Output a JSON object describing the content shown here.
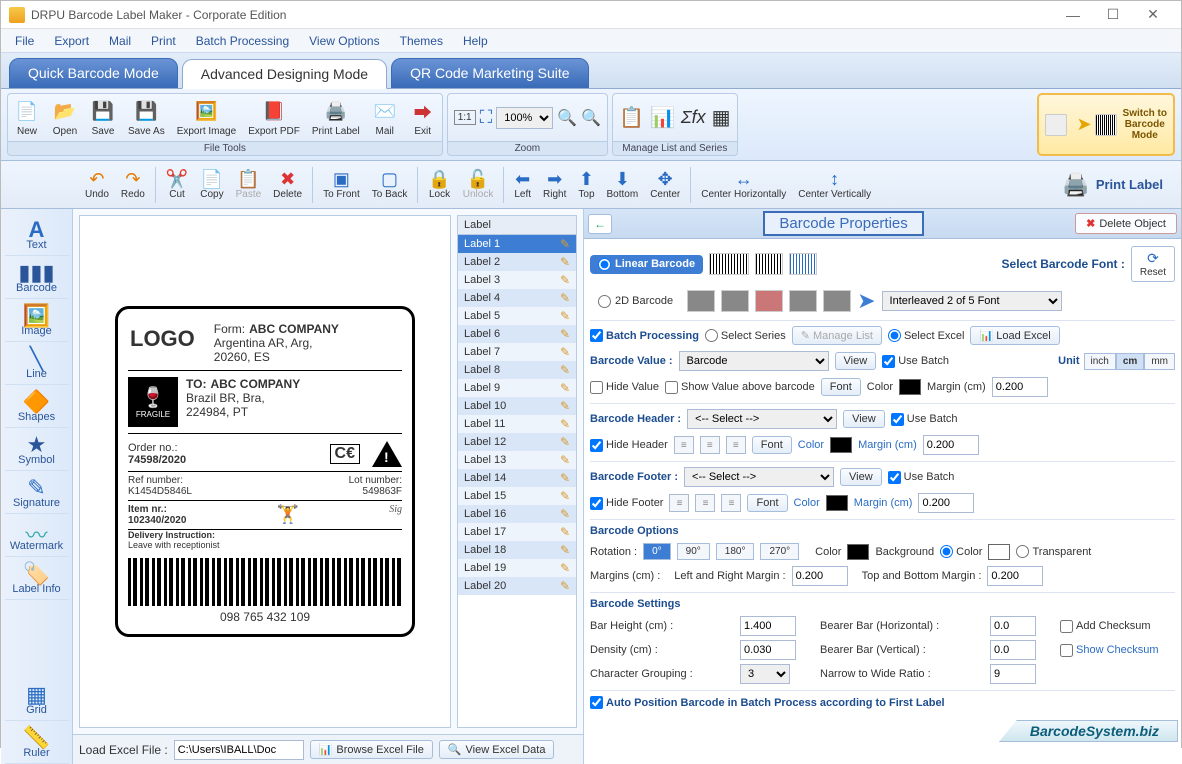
{
  "titlebar": {
    "title": "DRPU Barcode Label Maker - Corporate Edition"
  },
  "menu": {
    "file": "File",
    "export": "Export",
    "mail": "Mail",
    "print": "Print",
    "batch": "Batch Processing",
    "view": "View Options",
    "themes": "Themes",
    "help": "Help"
  },
  "modes": {
    "quick": "Quick Barcode Mode",
    "adv": "Advanced Designing Mode",
    "qr": "QR Code Marketing Suite"
  },
  "ribbon": {
    "file_tools": {
      "label": "File Tools",
      "new": "New",
      "open": "Open",
      "save": "Save",
      "saveas": "Save As",
      "exportimg": "Export Image",
      "exportpdf": "Export PDF",
      "printlabel": "Print Label",
      "mail": "Mail",
      "exit": "Exit"
    },
    "zoom": {
      "label": "Zoom",
      "value": "100%"
    },
    "manage": {
      "label": "Manage List and Series"
    },
    "switch": {
      "l1": "Switch to",
      "l2": "Barcode",
      "l3": "Mode"
    }
  },
  "editbar": {
    "undo": "Undo",
    "redo": "Redo",
    "cut": "Cut",
    "copy": "Copy",
    "paste": "Paste",
    "delete": "Delete",
    "tofront": "To Front",
    "toback": "To Back",
    "lock": "Lock",
    "unlock": "Unlock",
    "left": "Left",
    "right": "Right",
    "top": "Top",
    "bottom": "Bottom",
    "center": "Center",
    "centerh": "Center Horizontally",
    "centerv": "Center Vertically",
    "printlabel": "Print Label"
  },
  "lefttools": {
    "text": "Text",
    "barcode": "Barcode",
    "image": "Image",
    "line": "Line",
    "shapes": "Shapes",
    "symbol": "Symbol",
    "signature": "Signature",
    "watermark": "Watermark",
    "labelinfo": "Label Info",
    "grid": "Grid",
    "ruler": "Ruler"
  },
  "labelcard": {
    "logo": "LOGO",
    "from_label": "Form:",
    "from_company": "ABC COMPANY",
    "from_addr1": "Argentina AR, Arg,",
    "from_addr2": "20260, ES",
    "to_label": "TO:",
    "to_company": "ABC COMPANY",
    "to_addr1": "Brazil BR, Bra,",
    "to_addr2": "224984, PT",
    "fragile": "FRAGILE",
    "order_label": "Order no.:",
    "order_val": "74598/2020",
    "ce": "C€",
    "ref_label": "Ref number:",
    "ref_val": "K1454D5846L",
    "lot_label": "Lot number:",
    "lot_val": "549863F",
    "item_label": "Item nr.:",
    "item_val": "102340/2020",
    "deliv_label": "Delivery Instruction:",
    "deliv_val": "Leave with receptionist",
    "barcode_text": "098 765 432 109"
  },
  "labellist": {
    "header": "Label",
    "items": [
      "Label 1",
      "Label 2",
      "Label 3",
      "Label 4",
      "Label 5",
      "Label 6",
      "Label 7",
      "Label 8",
      "Label 9",
      "Label 10",
      "Label 11",
      "Label 12",
      "Label 13",
      "Label 14",
      "Label 15",
      "Label 16",
      "Label 17",
      "Label 18",
      "Label 19",
      "Label 20"
    ]
  },
  "bottombar": {
    "load_label": "Load Excel File :",
    "path": "C:\\Users\\IBALL\\Doc",
    "browse": "Browse Excel File",
    "view": "View Excel Data"
  },
  "props": {
    "title": "Barcode Properties",
    "delete": "Delete Object",
    "linear": "Linear Barcode",
    "twod": "2D Barcode",
    "select_font": "Select Barcode Font :",
    "font_sel": "Interleaved 2 of 5 Font",
    "reset": "Reset",
    "batch": "Batch Processing",
    "select_series": "Select Series",
    "manage_list": "Manage List",
    "select_excel": "Select Excel",
    "load_excel": "Load Excel",
    "barcode_value": "Barcode Value :",
    "bv_sel": "Barcode",
    "view": "View",
    "use_batch": "Use Batch",
    "unit": "Unit",
    "inch": "inch",
    "cm": "cm",
    "mm": "mm",
    "hide_value": "Hide Value",
    "show_above": "Show Value above barcode",
    "font": "Font",
    "color": "Color",
    "margin_cm": "Margin (cm)",
    "margin_val": "0.200",
    "header": "Barcode Header :",
    "header_sel": "<-- Select -->",
    "hide_header": "Hide Header",
    "header_margin": "0.200",
    "footer": "Barcode Footer :",
    "footer_sel": "<-- Select -->",
    "hide_footer": "Hide Footer",
    "footer_margin": "0.200",
    "options": "Barcode Options",
    "rotation": "Rotation :",
    "r0": "0°",
    "r90": "90°",
    "r180": "180°",
    "r270": "270°",
    "background": "Background",
    "transparent": "Transparent",
    "margins": "Margins (cm) :",
    "lr_margin": "Left and Right Margin :",
    "lr_val": "0.200",
    "tb_margin": "Top and Bottom Margin :",
    "tb_val": "0.200",
    "settings": "Barcode Settings",
    "barheight": "Bar Height (cm) :",
    "barheight_val": "1.400",
    "density": "Density (cm) :",
    "density_val": "0.030",
    "chargroup": "Character Grouping :",
    "chargroup_val": "3",
    "bearer_h": "Bearer Bar (Horizontal) :",
    "bearer_h_val": "0.0",
    "bearer_v": "Bearer Bar (Vertical) :",
    "bearer_v_val": "0.0",
    "narrow": "Narrow to Wide Ratio :",
    "narrow_val": "9",
    "add_checksum": "Add Checksum",
    "show_checksum": "Show Checksum",
    "auto_pos": "Auto Position Barcode in Batch Process according to First Label"
  },
  "brand": "BarcodeSystem.biz"
}
